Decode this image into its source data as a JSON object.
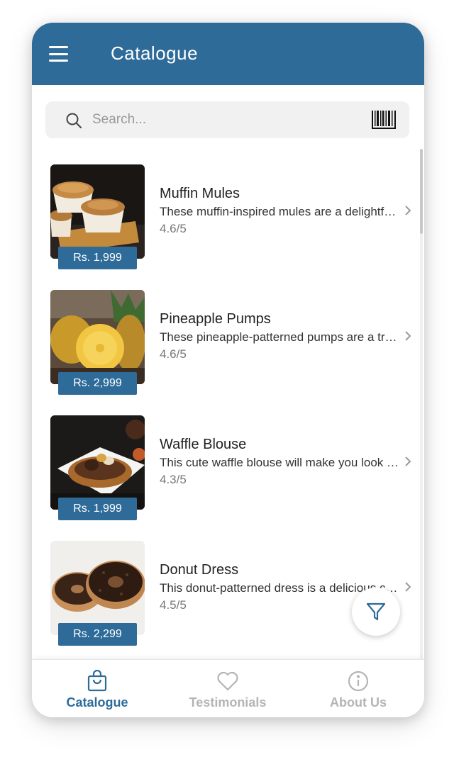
{
  "header": {
    "title": "Catalogue"
  },
  "search": {
    "placeholder": "Search..."
  },
  "items": [
    {
      "title": "Muffin Mules",
      "description": "These muffin-inspired mules are a delightful treat for your feet.",
      "rating": "4.6/5",
      "price": "Rs. 1,999"
    },
    {
      "title": "Pineapple Pumps",
      "description": "These pineapple-patterned pumps are a tropical delight.",
      "rating": "4.6/5",
      "price": "Rs. 2,999"
    },
    {
      "title": "Waffle Blouse",
      "description": "This cute waffle blouse will make you look sweet.",
      "rating": "4.3/5",
      "price": "Rs. 1,999"
    },
    {
      "title": "Donut Dress",
      "description": "This donut-patterned dress is a delicious choice.",
      "rating": "4.5/5",
      "price": "Rs. 2,299"
    }
  ],
  "tabs": [
    {
      "label": "Catalogue",
      "icon": "shopping-bag-icon",
      "active": true
    },
    {
      "label": "Testimonials",
      "icon": "heart-icon",
      "active": false
    },
    {
      "label": "About Us",
      "icon": "info-icon",
      "active": false
    }
  ],
  "colors": {
    "brand": "#2e6b99",
    "inactive": "#b4b4b4"
  }
}
